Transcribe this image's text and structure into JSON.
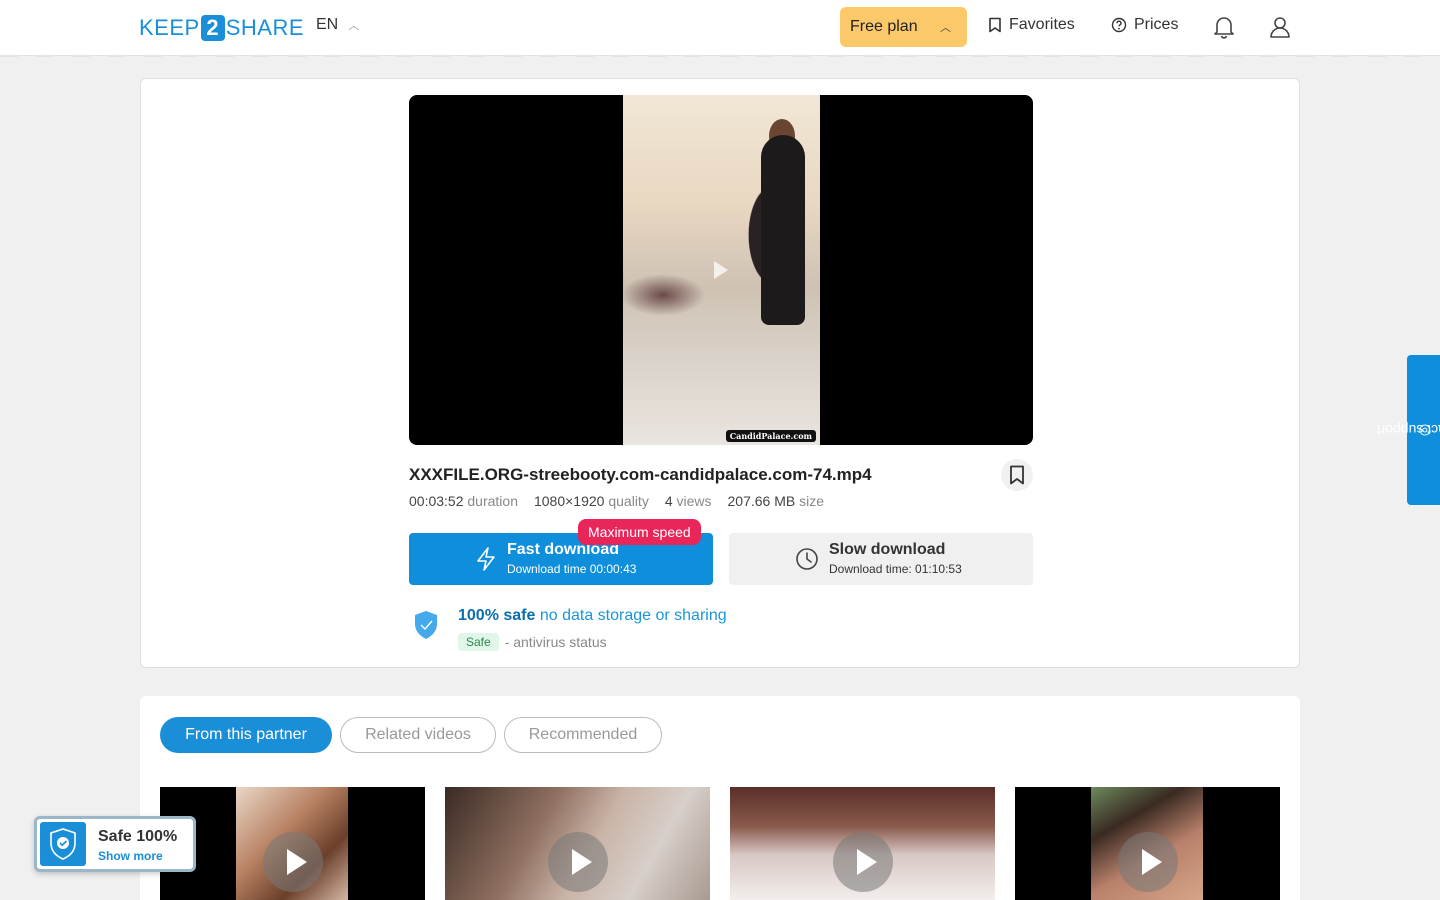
{
  "header": {
    "logo_left": "KEEP",
    "logo_mid": "2",
    "logo_right": "SHARE",
    "language": "EN",
    "plan_label": "Free plan",
    "favorites_label": "Favorites",
    "prices_label": "Prices"
  },
  "file": {
    "title": "XXXFILE.ORG-streebooty.com-candidpalace.com-74.mp4",
    "watermark": "CandidPalace.com",
    "duration_value": "00:03:52",
    "duration_label": "duration",
    "quality_value": "1080×1920",
    "quality_label": "quality",
    "views_value": "4",
    "views_label": "views",
    "size_value": "207.66 MB",
    "size_label": "size"
  },
  "download": {
    "fast_label": "Fast download",
    "fast_time": "Download time 00:00:43",
    "max_badge": "Maximum speed",
    "slow_label": "Slow download",
    "slow_time": "Download time: 01:10:53"
  },
  "safety": {
    "headline_strong": "100% safe",
    "headline_rest": "no data storage or sharing",
    "status_pill": "Safe",
    "status_text": "- antivirus status"
  },
  "related": {
    "tabs": [
      {
        "label": "From this partner",
        "active": true
      },
      {
        "label": "Related videos",
        "active": false
      },
      {
        "label": "Recommended",
        "active": false
      }
    ]
  },
  "side": {
    "contact_label": "contact support"
  },
  "widget": {
    "title": "Safe 100%",
    "link": "Show more"
  },
  "colors": {
    "accent": "#0f8edc",
    "plan": "#fcc96a",
    "badge": "#e8265a"
  }
}
